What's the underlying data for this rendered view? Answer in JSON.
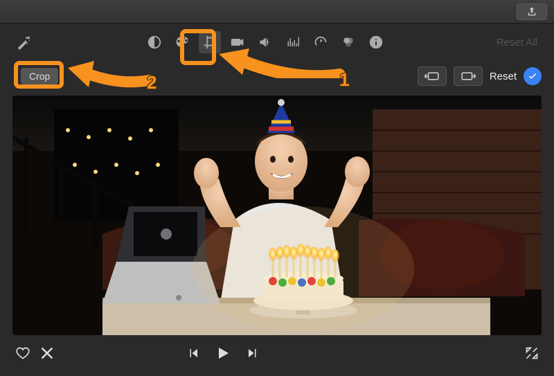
{
  "titlebar": {
    "share_tooltip": "Share"
  },
  "toolbar": {
    "icons": {
      "enhance": "magic-wand-icon",
      "contrast": "contrast-icon",
      "color": "palette-icon",
      "crop": "crop-icon",
      "stabilize": "camera-icon",
      "volume": "speaker-icon",
      "noise": "equalizer-icon",
      "speed": "speedometer-icon",
      "filters": "circles-icon",
      "info": "info-icon"
    },
    "reset_all_label": "Reset All"
  },
  "cropbar": {
    "crop_label": "Crop",
    "rotate_ccw": "rotate-ccw",
    "rotate_cw": "rotate-cw",
    "reset_label": "Reset"
  },
  "playbar": {
    "favorite": "heart-icon",
    "reject": "x-icon",
    "prev": "previous-icon",
    "play": "play-icon",
    "next": "next-icon",
    "expand": "expand-icon"
  },
  "annotations": {
    "step1_number": "1",
    "step2_number": "2"
  },
  "preview": {
    "description": "Young man in white t-shirt and birthday hat smiling with hands raised, sitting at table with a birthday cake and lit candles, a laptop to the left, brown leather couch and loft brick wall with string lights behind"
  }
}
